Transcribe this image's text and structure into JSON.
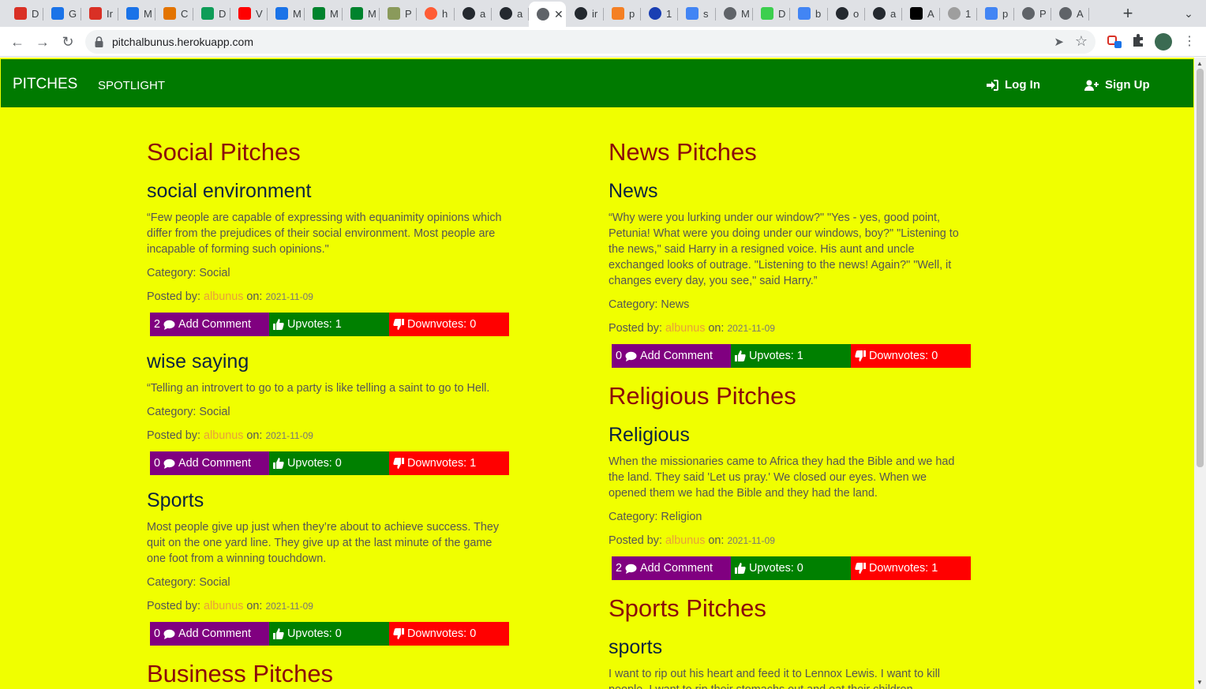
{
  "browser": {
    "tabs": [
      {
        "icon": "gmail-icon",
        "label": "D",
        "color": "#d93025"
      },
      {
        "icon": "calendar-icon",
        "label": "G",
        "color": "#1a73e8"
      },
      {
        "icon": "gmail-icon",
        "label": "Ir",
        "color": "#d93025"
      },
      {
        "icon": "calendar-icon",
        "label": "M",
        "color": "#1a73e8"
      },
      {
        "icon": "colorful-swirl-icon",
        "label": "C",
        "color": "#e37400"
      },
      {
        "icon": "google-drive-icon",
        "label": "D",
        "color": "#0f9d58"
      },
      {
        "icon": "youtube-icon",
        "label": "V",
        "color": "#ff0000"
      },
      {
        "icon": "calendar-icon",
        "label": "M",
        "color": "#1a73e8"
      },
      {
        "icon": "google-meet-icon",
        "label": "M",
        "color": "#00832d"
      },
      {
        "icon": "google-meet-icon",
        "label": "M",
        "color": "#00832d"
      },
      {
        "icon": "palm-tree-icon",
        "label": "P",
        "color": "#8a9a5b"
      },
      {
        "icon": "orange-circle-icon",
        "label": "h",
        "color": "#ff5c35"
      },
      {
        "icon": "github-icon",
        "label": "a",
        "color": "#24292f"
      },
      {
        "icon": "github-icon",
        "label": "a",
        "color": "#24292f"
      },
      {
        "icon": "globe-icon",
        "label": "",
        "color": "#5f6368",
        "active": true
      },
      {
        "icon": "github-icon",
        "label": "ir",
        "color": "#24292f"
      },
      {
        "icon": "stackoverflow-icon",
        "label": "p",
        "color": "#f48024"
      },
      {
        "icon": "spiral-icon",
        "label": "1",
        "color": "#1a3fb3"
      },
      {
        "icon": "google-icon",
        "label": "s",
        "color": "#4285f4"
      },
      {
        "icon": "globe-icon",
        "label": "M",
        "color": "#5f6368"
      },
      {
        "icon": "dashed-square-icon",
        "label": "D",
        "color": "#3ccf4e"
      },
      {
        "icon": "google-icon",
        "label": "b",
        "color": "#4285f4"
      },
      {
        "icon": "github-icon",
        "label": "o",
        "color": "#24292f"
      },
      {
        "icon": "github-icon",
        "label": "a",
        "color": "#24292f"
      },
      {
        "icon": "w3-icon",
        "label": "A",
        "color": "#000000"
      },
      {
        "icon": "grey-circle-icon",
        "label": "1",
        "color": "#9e9e9e"
      },
      {
        "icon": "google-icon",
        "label": "p",
        "color": "#4285f4"
      },
      {
        "icon": "globe-icon",
        "label": "P",
        "color": "#5f6368"
      },
      {
        "icon": "globe-icon",
        "label": "A",
        "color": "#5f6368"
      }
    ],
    "url": "pitchalbunus.herokuapp.com"
  },
  "navbar": {
    "brand": "PITCHES",
    "spotlight": "SPOTLIGHT",
    "login": "Log In",
    "signup": "Sign Up"
  },
  "labels": {
    "category_prefix": "Category:",
    "posted_by": "Posted by:",
    "on": "on:",
    "add_comment": "Add Comment",
    "upvotes": "Upvotes:",
    "downvotes": "Downvotes:"
  },
  "left": {
    "social_title": "Social Pitches",
    "pitches": [
      {
        "title": "social environment",
        "body": "“Few people are capable of expressing with equanimity opinions which differ from the prejudices of their social environment. Most people are incapable of forming such opinions.\"",
        "category": "Social",
        "author": "albunus",
        "date": "2021-11-09",
        "comments": "2",
        "upvotes": "1",
        "downvotes": "0"
      },
      {
        "title": "wise saying",
        "body": "“Telling an introvert to go to a party is like telling a saint to go to Hell.",
        "category": "Social",
        "author": "albunus",
        "date": "2021-11-09",
        "comments": "0",
        "upvotes": "0",
        "downvotes": "1"
      },
      {
        "title": "Sports",
        "body": "Most people give up just when they’re about to achieve success. They quit on the one yard line. They give up at the last minute of the game one foot from a winning touchdown.",
        "category": "Social",
        "author": "albunus",
        "date": "2021-11-09",
        "comments": "0",
        "upvotes": "0",
        "downvotes": "0"
      }
    ],
    "business_title": "Business Pitches"
  },
  "right": {
    "news_title": "News Pitches",
    "news": {
      "title": "News",
      "body": "“Why were you lurking under our window?\" \"Yes - yes, good point, Petunia! What were you doing under our windows, boy?\" \"Listening to the news,\" said Harry in a resigned voice. His aunt and uncle exchanged looks of outrage. \"Listening to the news! Again?\" \"Well, it changes every day, you see,\" said Harry.”",
      "category": "News",
      "author": "albunus",
      "date": "2021-11-09",
      "comments": "0",
      "upvotes": "1",
      "downvotes": "0"
    },
    "religious_title": "Religious Pitches",
    "religious": {
      "title": "Religious",
      "body": "When the missionaries came to Africa they had the Bible and we had the land. They said 'Let us pray.' We closed our eyes. When we opened them we had the Bible and they had the land.",
      "category": "Religion",
      "author": "albunus",
      "date": "2021-11-09",
      "comments": "2",
      "upvotes": "0",
      "downvotes": "1"
    },
    "sports_title": "Sports Pitches",
    "sports": {
      "title": "sports",
      "body": "I want to rip out his heart and feed it to Lennox Lewis. I want to kill people. I want to rip their stomachs out and eat their children."
    }
  }
}
